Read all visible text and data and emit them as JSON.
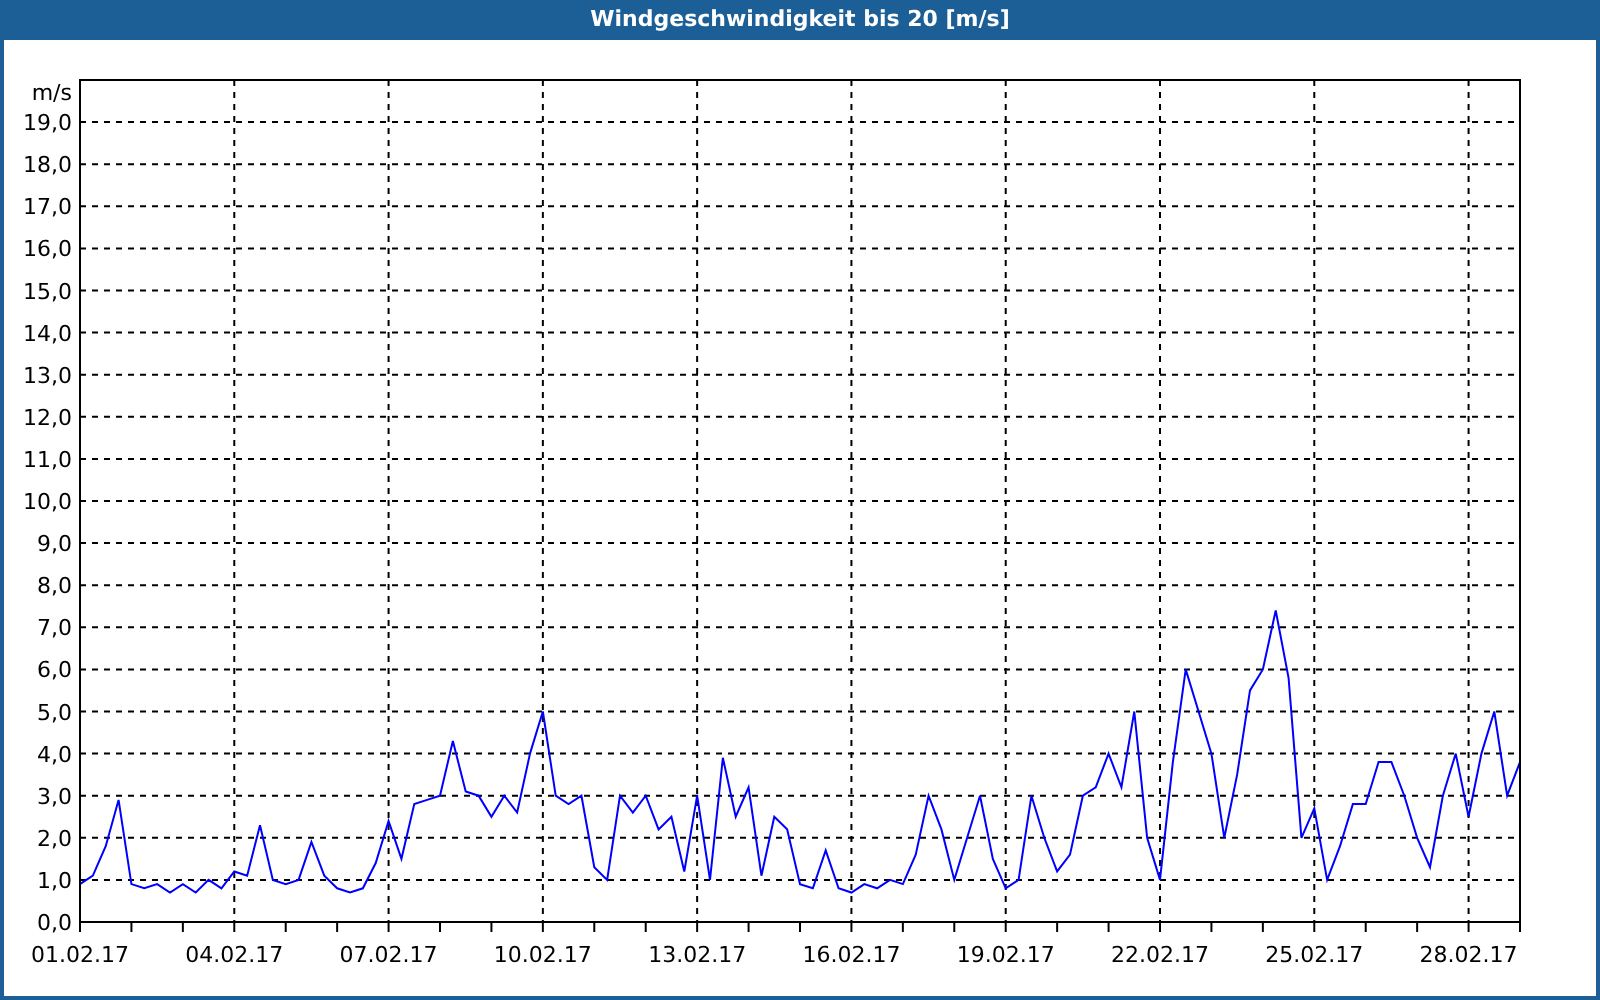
{
  "window": {
    "title": "Windgeschwindigkeit bis 20 [m/s]"
  },
  "chart": {
    "chart_data": {
      "type": "line",
      "ylabel": "m/s",
      "categories": [
        "01.02.17",
        null,
        null,
        null,
        null,
        null,
        null,
        null,
        null,
        null,
        null,
        null,
        "04.02.17",
        null,
        null,
        null,
        null,
        null,
        null,
        null,
        null,
        null,
        null,
        null,
        "07.02.17",
        null,
        null,
        null,
        null,
        null,
        null,
        null,
        null,
        null,
        null,
        null,
        "10.02.17",
        null,
        null,
        null,
        null,
        null,
        null,
        null,
        null,
        null,
        null,
        null,
        "13.02.17",
        null,
        null,
        null,
        null,
        null,
        null,
        null,
        null,
        null,
        null,
        null,
        "16.02.17",
        null,
        null,
        null,
        null,
        null,
        null,
        null,
        null,
        null,
        null,
        null,
        "19.02.17",
        null,
        null,
        null,
        null,
        null,
        null,
        null,
        null,
        null,
        null,
        null,
        "22.02.17",
        null,
        null,
        null,
        null,
        null,
        null,
        null,
        null,
        null,
        null,
        null,
        "25.02.17",
        null,
        null,
        null,
        null,
        null,
        null,
        null,
        null,
        null,
        null,
        null,
        "28.02.17",
        null,
        null,
        null,
        null
      ],
      "series": [
        {
          "color": "#0000ff",
          "values": [
            0.9,
            1.1,
            1.8,
            2.9,
            0.9,
            0.8,
            0.9,
            0.7,
            0.9,
            0.7,
            1.0,
            0.8,
            1.2,
            1.1,
            2.3,
            1.0,
            0.9,
            1.0,
            1.9,
            1.1,
            0.8,
            0.7,
            0.8,
            1.4,
            2.4,
            1.5,
            2.8,
            2.9,
            3.0,
            4.3,
            3.1,
            3.0,
            2.5,
            3.0,
            2.6,
            4.0,
            5.0,
            3.0,
            2.8,
            3.0,
            1.3,
            1.0,
            3.0,
            2.6,
            3.0,
            2.2,
            2.5,
            1.2,
            3.0,
            1.0,
            3.9,
            2.5,
            3.2,
            1.1,
            2.5,
            2.2,
            0.9,
            0.8,
            1.7,
            0.8,
            0.7,
            0.9,
            0.8,
            1.0,
            0.9,
            1.6,
            3.0,
            2.2,
            1.0,
            2.0,
            3.0,
            1.5,
            0.8,
            1.0,
            3.0,
            2.0,
            1.2,
            1.6,
            3.0,
            3.2,
            4.0,
            3.2,
            5.0,
            2.0,
            1.0,
            3.8,
            6.0,
            5.0,
            4.0,
            2.0,
            3.5,
            5.5,
            6.0,
            7.4,
            5.8,
            2.0,
            2.7,
            1.0,
            1.8,
            2.8,
            2.8,
            3.8,
            3.8,
            3.0,
            2.0,
            1.3,
            3.0,
            4.0,
            2.5,
            4.0,
            5.0,
            3.0,
            3.8
          ]
        }
      ],
      "ylim": [
        0,
        20
      ],
      "grid": true,
      "yticks": [
        {
          "value": 0,
          "label": "0,0"
        },
        {
          "value": 1,
          "label": "1,0"
        },
        {
          "value": 2,
          "label": "2,0"
        },
        {
          "value": 3,
          "label": "3,0"
        },
        {
          "value": 4,
          "label": "4,0"
        },
        {
          "value": 5,
          "label": "5,0"
        },
        {
          "value": 6,
          "label": "6,0"
        },
        {
          "value": 7,
          "label": "7,0"
        },
        {
          "value": 8,
          "label": "8,0"
        },
        {
          "value": 9,
          "label": "9,0"
        },
        {
          "value": 10,
          "label": "10,0"
        },
        {
          "value": 11,
          "label": "11,0"
        },
        {
          "value": 12,
          "label": "12,0"
        },
        {
          "value": 13,
          "label": "13,0"
        },
        {
          "value": 14,
          "label": "14,0"
        },
        {
          "value": 15,
          "label": "15,0"
        },
        {
          "value": 16,
          "label": "16,0"
        },
        {
          "value": 17,
          "label": "17,0"
        },
        {
          "value": 18,
          "label": "18,0"
        },
        {
          "value": 19,
          "label": "19,0"
        }
      ]
    }
  }
}
